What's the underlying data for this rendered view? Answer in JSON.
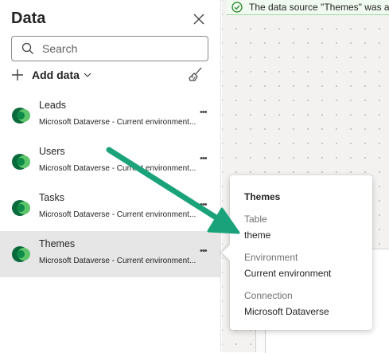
{
  "pane": {
    "title": "Data",
    "search_placeholder": "Search",
    "add_data_label": "Add data"
  },
  "items": [
    {
      "name": "Leads",
      "subtitle": "Microsoft Dataverse - Current environment..."
    },
    {
      "name": "Users",
      "subtitle": "Microsoft Dataverse - Current environment..."
    },
    {
      "name": "Tasks",
      "subtitle": "Microsoft Dataverse - Current environment..."
    },
    {
      "name": "Themes",
      "subtitle": "Microsoft Dataverse - Current environment..."
    }
  ],
  "selected_item": "Themes",
  "banner": {
    "text": "The data source \"Themes\" was added"
  },
  "flyout": {
    "title": "Themes",
    "table_label": "Table",
    "table_value": "theme",
    "environment_label": "Environment",
    "environment_value": "Current environment",
    "connection_label": "Connection",
    "connection_value": "Microsoft Dataverse"
  },
  "colors": {
    "annotation_arrow": "#1aa37a",
    "dataverse_green_dark": "#0b6a3b",
    "dataverse_green_light": "#5ec46a",
    "success": "#107c10"
  }
}
